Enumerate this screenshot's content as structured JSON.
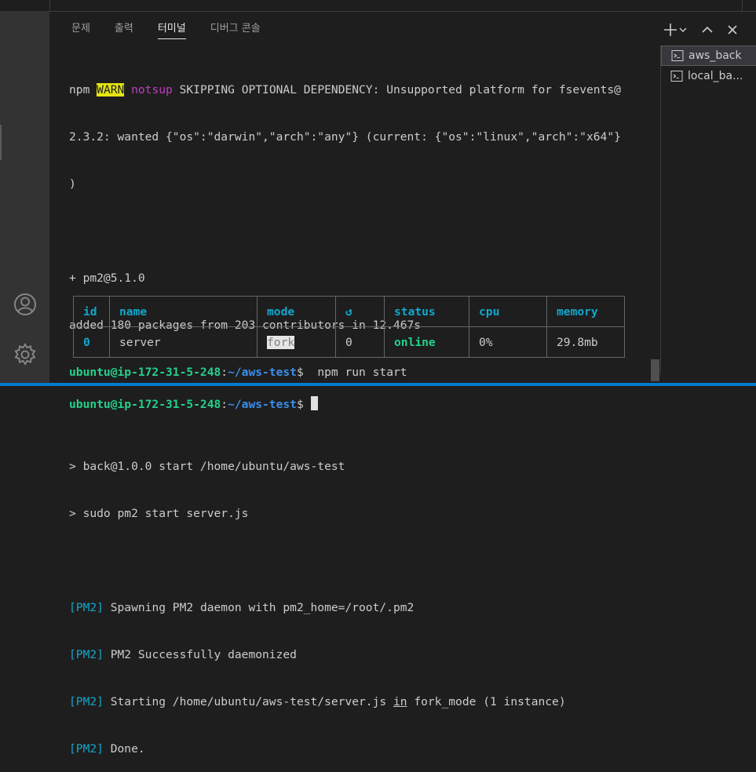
{
  "panel": {
    "tabs": [
      "문제",
      "출력",
      "터미널",
      "디버그 콘솔"
    ],
    "active_tab": "터미널"
  },
  "terminal": {
    "line1": {
      "npm": "npm ",
      "warn": "WARN",
      "notsup": "notsup",
      "rest": " SKIPPING OPTIONAL DEPENDENCY: Unsupported platform for fsevents@"
    },
    "line2": "2.3.2: wanted {\"os\":\"darwin\",\"arch\":\"any\"} (current: {\"os\":\"linux\",\"arch\":\"x64\"}",
    "line3": ")",
    "pm2_installed": "+ pm2@5.1.0",
    "added": "added 180 packages from 203 contributors in 12.467s",
    "prompt": {
      "user": "ubuntu@ip-172-31-5-248",
      "colon": ":",
      "path": "~/aws-test",
      "dollar": "$",
      "command": "  npm run start"
    },
    "script1": "> back@1.0.0 start /home/ubuntu/aws-test",
    "script2": "> sudo pm2 start server.js",
    "pm2_tag": "[PM2]",
    "pm2_lines": [
      " Spawning PM2 daemon with pm2_home=/root/.pm2",
      " PM2 Successfully daemonized",
      " Done."
    ],
    "starting": {
      "pre": " Starting /home/ubuntu/aws-test/server.js ",
      "in": "in",
      "post": " fork_mode (1 instance)"
    },
    "final_prompt": {
      "user": "ubuntu@ip-172-31-5-248",
      "colon": ":",
      "path": "~/aws-test",
      "dollar": "$ "
    }
  },
  "pm2_table": {
    "headers": [
      "id",
      "name",
      "mode",
      "↺",
      "status",
      "cpu",
      "memory"
    ],
    "row": {
      "id": "0",
      "name": "server",
      "mode": "fork",
      "restarts": "0",
      "status": "online",
      "cpu": "0%",
      "memory": "29.8mb"
    }
  },
  "terminal_list": [
    {
      "label": "aws_back",
      "icon": "terminal-icon"
    },
    {
      "label": "local_ba...",
      "icon": "terminal-icon"
    }
  ],
  "colors": {
    "accent": "#007acc",
    "green": "#23d18b",
    "cyan": "#11a8cd",
    "warn": "#e5e510",
    "magenta": "#bc3fbc"
  }
}
